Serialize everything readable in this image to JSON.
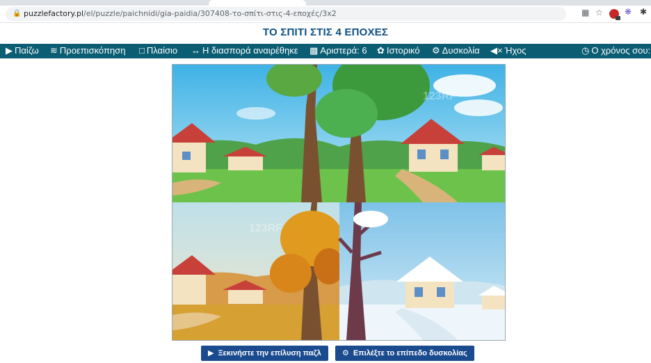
{
  "browser": {
    "url_host": "puzzlefactory.pl",
    "url_path": "/el/puzzle/paichnidi/gia-paidia/307408-το-σπίτι-στις-4-εποχές/3x2"
  },
  "page": {
    "title": "ΤΟ ΣΠΙΤΙ ΣΤΙΣ 4 ΕΠΟΧΕΣ"
  },
  "toolbar": {
    "play": "Παίζω",
    "preview": "Προεπισκόπηση",
    "frame": "Πλαίσιο",
    "scatter": "Η διασπορά αναιρέθηκε",
    "left": "Αριστερά: 6",
    "history": "Ιστορικό",
    "difficulty": "Δυσκολία",
    "sound": "Ήχος",
    "time": "Ο χρόνος σου:"
  },
  "buttons": {
    "start": "Ξεκινήστε την επίλυση παζλ",
    "choose_level": "Επιλέξτε το επίπεδο δυσκολίας"
  },
  "watermark": "123RF",
  "colors": {
    "toolbar_bg": "#0b5d73",
    "title": "#0b4f86",
    "button_bg": "#1b4b8f"
  },
  "icons": [
    "lock-icon",
    "translate-icon",
    "star-icon",
    "extension-icon",
    "settings-icon",
    "puzzle-extension-icon",
    "play-circle-icon",
    "eye-icon",
    "square-icon",
    "arrows-icon",
    "pieces-icon",
    "palette-icon",
    "cogs-icon",
    "volume-off-icon",
    "clock-icon"
  ]
}
